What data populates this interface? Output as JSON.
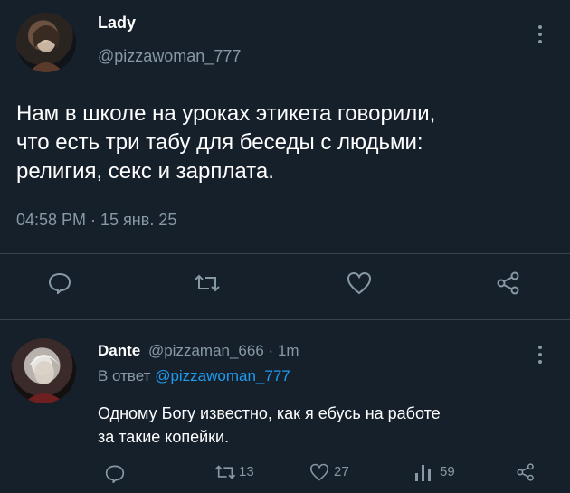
{
  "tweet": {
    "author_name": "Lady",
    "author_handle": "@pizzawoman_777",
    "text_lines": [
      "Нам в школе на уроках этикета говорили,",
      "что есть три табу для беседы с людьми:",
      "религия, секс и зарплата."
    ],
    "meta": "04:58 PM · 15 янв. 25"
  },
  "reply": {
    "author_name": "Dante",
    "author_handle": "@pizzaman_666",
    "separator": "·",
    "time": "1m",
    "reply_to_prefix": "В ответ",
    "reply_to_handle": "@pizzawoman_777",
    "text_lines": [
      "Одному Богу известно, как я ебусь на работе",
      "за такие копейки."
    ],
    "retweets": "13",
    "likes": "27",
    "views": "59"
  },
  "colors": {
    "background": "#15202b",
    "muted": "#8899a6",
    "link": "#1d9bf0",
    "divider": "#38444d"
  },
  "icons": [
    "more-icon",
    "reply-icon",
    "retweet-icon",
    "like-icon",
    "share-icon",
    "views-icon"
  ]
}
